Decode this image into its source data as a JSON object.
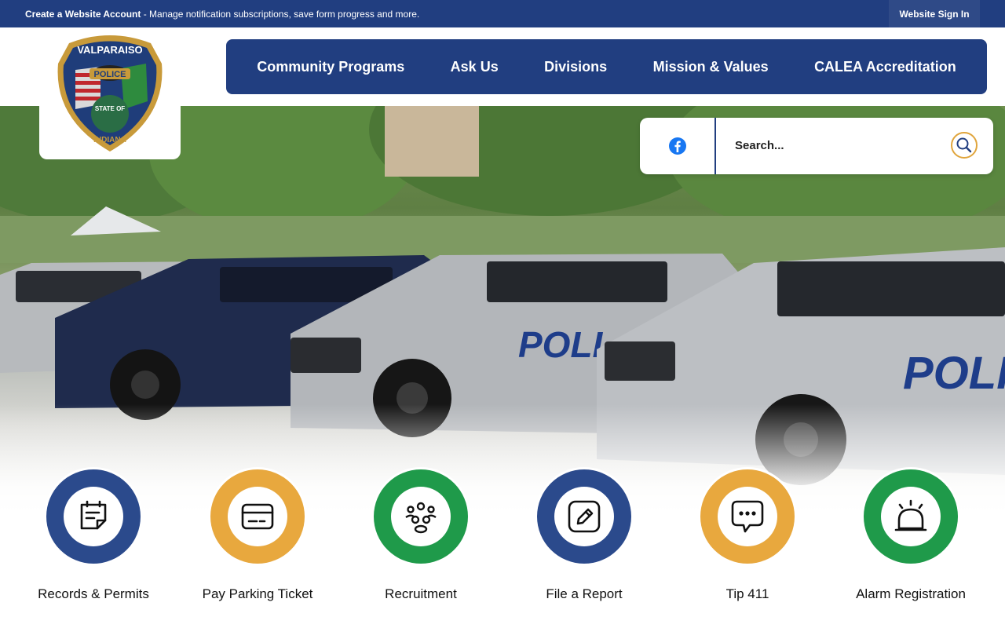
{
  "topbar": {
    "notice_bold": "Create a Website Account",
    "notice_rest": " - Manage notification subscriptions, save form progress and more.",
    "signin_label": "Website Sign In"
  },
  "logo": {
    "top_text": "VALPARAISO",
    "badge_text": "POLICE",
    "state_text": "STATE OF",
    "bottom_text": "INDIANA"
  },
  "nav": {
    "items": [
      {
        "label": "Community Programs"
      },
      {
        "label": "Ask Us"
      },
      {
        "label": "Divisions"
      },
      {
        "label": "Mission & Values"
      },
      {
        "label": "CALEA Accreditation"
      }
    ]
  },
  "search": {
    "placeholder": "Search...",
    "facebook_icon": "facebook-icon",
    "search_icon": "search-icon"
  },
  "quick_links": [
    {
      "label": "Records & Permits",
      "icon": "document-note-icon",
      "color": "#2b4a8c"
    },
    {
      "label": "Pay Parking Ticket",
      "icon": "card-icon",
      "color": "#e8a83e"
    },
    {
      "label": "Recruitment",
      "icon": "people-icon",
      "color": "#1f9a4a"
    },
    {
      "label": "File a Report",
      "icon": "edit-pencil-icon",
      "color": "#2b4a8c"
    },
    {
      "label": "Tip 411",
      "icon": "chat-bubble-icon",
      "color": "#e8a83e"
    },
    {
      "label": "Alarm Registration",
      "icon": "alarm-bell-icon",
      "color": "#1f9a4a"
    }
  ],
  "colors": {
    "primary_blue": "#213e80",
    "gold": "#e8a83e",
    "green": "#1f9a4a"
  }
}
